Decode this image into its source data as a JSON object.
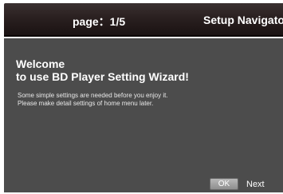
{
  "header": {
    "page_indicator": "page：1/5",
    "title": "Setup Navigator"
  },
  "welcome": {
    "line1": "Welcome",
    "line2": "to use BD Player Setting Wizard!"
  },
  "description": {
    "line1": "Some simple settings are needed before you enjoy it.",
    "line2": "Please make detail settings of home menu later."
  },
  "footer": {
    "ok_label": "OK",
    "next_label": "Next"
  },
  "colors": {
    "header_bg": "#2a2020",
    "panel_bg": "#4c4c4c",
    "text": "#ffffff",
    "button_bg": "#a0a0a0"
  }
}
